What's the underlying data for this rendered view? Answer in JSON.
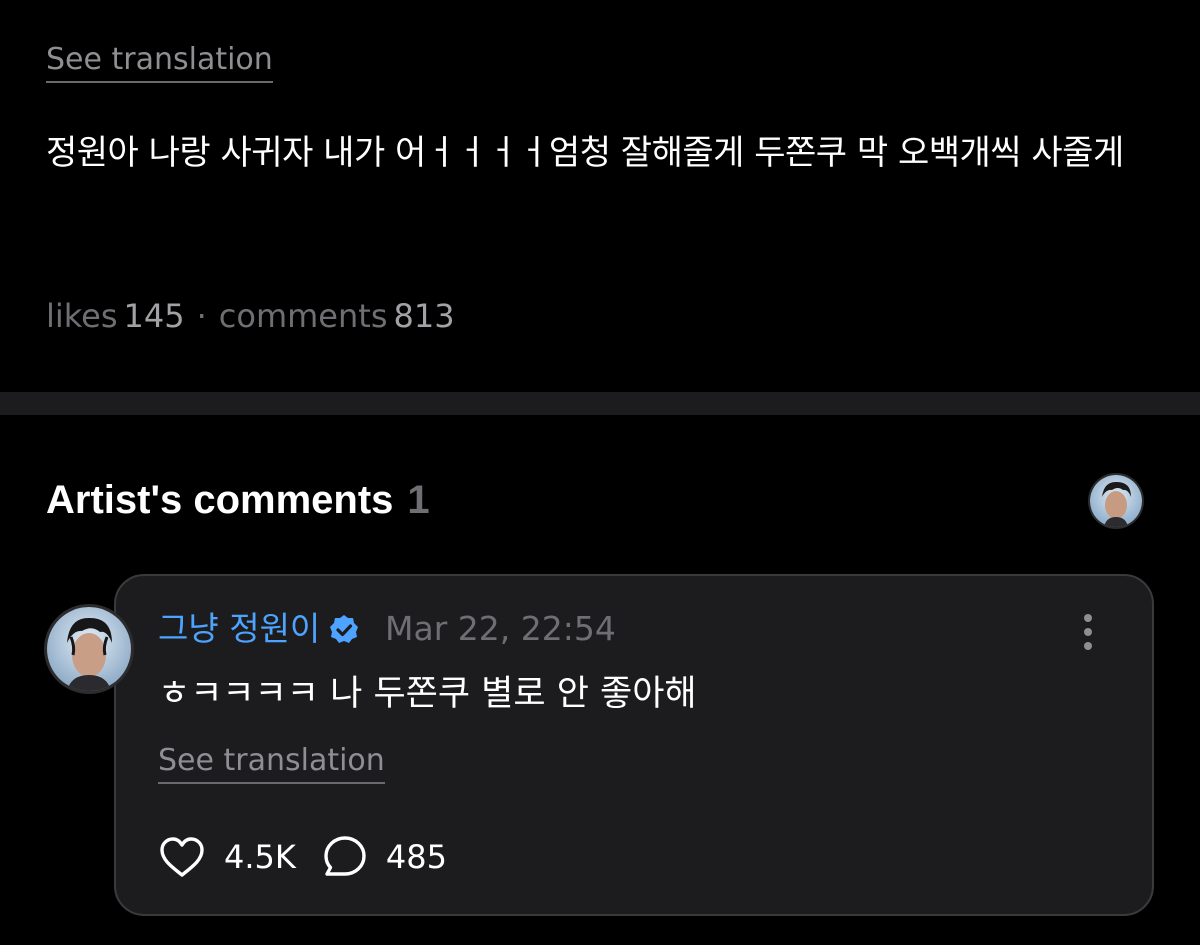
{
  "post": {
    "see_translation": "See translation",
    "body": "정원아 나랑 사귀자 내가 어ㅓㅓㅓㅓ엄청 잘해줄게 두쫀쿠 막 오백개씩 사줄게",
    "likes_label": "likes",
    "likes_count": "145",
    "separator": "·",
    "comments_label": "comments",
    "comments_count": "813"
  },
  "artist_comments": {
    "title": "Artist's comments",
    "count": "1"
  },
  "comment": {
    "author": "그냥 정원이",
    "time": "Mar 22, 22:54",
    "text": "ㅎㅋㅋㅋㅋ 나 두쫀쿠 별로 안 좋아해",
    "see_translation": "See translation",
    "likes": "4.5K",
    "replies": "485"
  },
  "icons": {
    "verified": "verified-check-icon",
    "more": "more-vertical-icon",
    "heart": "heart-icon",
    "reply": "comment-bubble-icon"
  },
  "colors": {
    "background": "#000000",
    "card": "#1c1c1e",
    "author": "#4ea3ff",
    "muted": "#8e8e93"
  }
}
